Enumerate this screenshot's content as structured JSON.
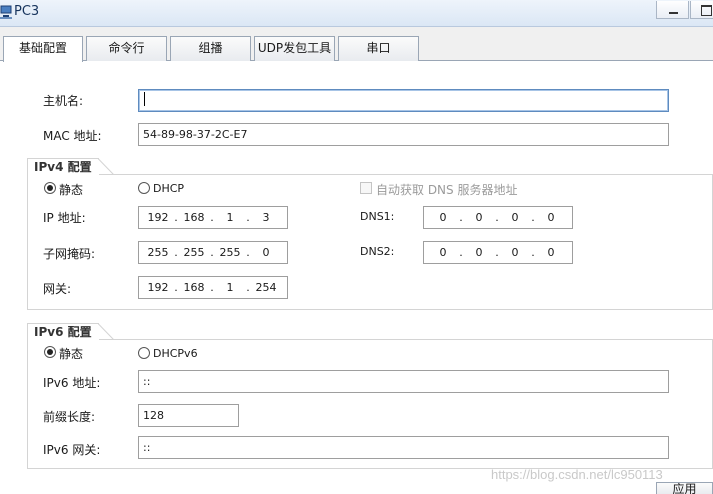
{
  "window": {
    "title": "PC3"
  },
  "tabs": [
    {
      "label": "基础配置"
    },
    {
      "label": "命令行"
    },
    {
      "label": "组播"
    },
    {
      "label": "UDP发包工具"
    },
    {
      "label": "串口"
    }
  ],
  "basic": {
    "hostname_label": "主机名:",
    "hostname_value": "",
    "mac_label": "MAC 地址:",
    "mac_value": "54-89-98-37-2C-E7"
  },
  "ipv4": {
    "group_title": "IPv4 配置",
    "static_label": "静态",
    "dhcp_label": "DHCP",
    "static_selected": true,
    "auto_dns_label": "自动获取 DNS 服务器地址",
    "ip_label": "IP 地址:",
    "ip": [
      "192",
      "168",
      "1",
      "3"
    ],
    "mask_label": "子网掩码:",
    "mask": [
      "255",
      "255",
      "255",
      "0"
    ],
    "gateway_label": "网关:",
    "gateway": [
      "192",
      "168",
      "1",
      "254"
    ],
    "dns1_label": "DNS1:",
    "dns1": [
      "0",
      "0",
      "0",
      "0"
    ],
    "dns2_label": "DNS2:",
    "dns2": [
      "0",
      "0",
      "0",
      "0"
    ]
  },
  "ipv6": {
    "group_title": "IPv6 配置",
    "static_label": "静态",
    "dhcpv6_label": "DHCPv6",
    "static_selected": true,
    "address_label": "IPv6 地址:",
    "address_value": "::",
    "prefix_label": "前缀长度:",
    "prefix_value": "128",
    "gateway_label": "IPv6 网关:",
    "gateway_value": "::"
  },
  "footer": {
    "apply_label": "应用",
    "watermark": "https://blog.csdn.net/lc950113"
  },
  "colors": {
    "titlebar": "#dbe7f5",
    "focus_border": "#5e8bbf",
    "group_border": "#d4d4d4"
  }
}
